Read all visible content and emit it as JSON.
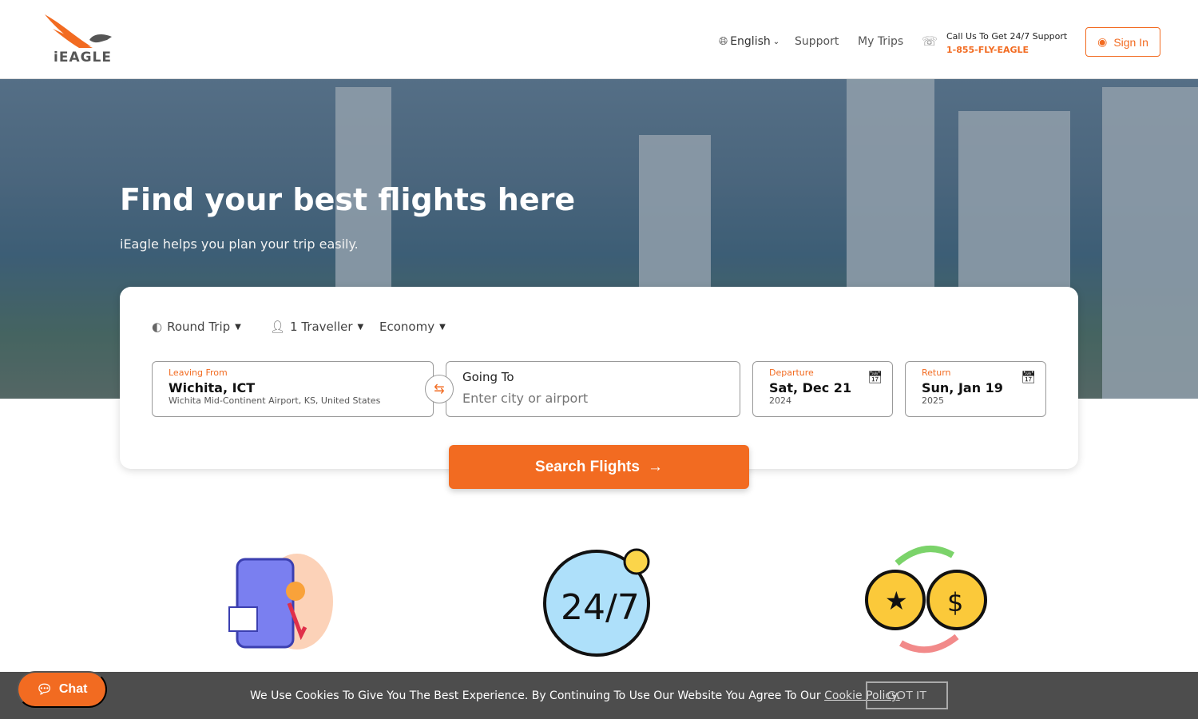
{
  "brand": {
    "name": "iEAGLE",
    "accent": "#f26b21"
  },
  "nav": {
    "language": "English",
    "support": "Support",
    "my_trips": "My Trips",
    "call_text": "Call Us To Get 24/7 Support",
    "phone": "1-855-FLY-EAGLE",
    "sign_in": "Sign In"
  },
  "hero": {
    "title": "Find your best flights here",
    "subtitle": "iEagle helps you plan your trip easily."
  },
  "search": {
    "trip_type": "Round Trip",
    "travellers": "1 Traveller",
    "cabin": "Economy",
    "from": {
      "label": "Leaving From",
      "value": "Wichita, ICT",
      "detail": "Wichita Mid-Continent Airport, KS, United States"
    },
    "to": {
      "label": "Going To",
      "placeholder": "Enter city or airport"
    },
    "departure": {
      "label": "Departure",
      "date": "Sat, Dec 21",
      "year": "2024"
    },
    "return": {
      "label": "Return",
      "date": "Sun, Jan 19",
      "year": "2025"
    },
    "button": "Search Flights"
  },
  "features": [
    {
      "icon": "luggage-price-drop-icon"
    },
    {
      "icon": "support-24-7-icon"
    },
    {
      "icon": "coin-exchange-icon"
    }
  ],
  "cookie": {
    "text": "We Use Cookies To Give You The Best Experience. By Continuing To Use Our Website You Agree To Our ",
    "link": "Cookie Policy.",
    "button": "GOT IT"
  },
  "chat": {
    "label": "Chat"
  }
}
